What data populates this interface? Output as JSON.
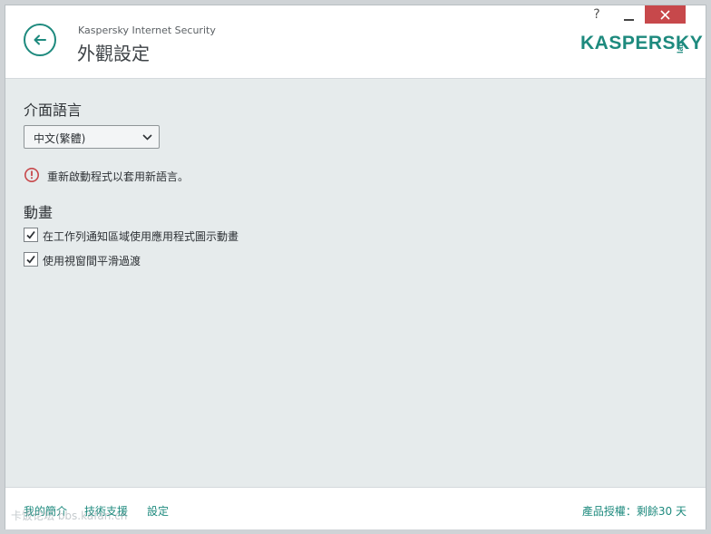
{
  "window": {
    "app_name": "Kaspersky Internet Security",
    "page_title": "外觀設定",
    "help_label": "?",
    "logo_text": "KASPERSKY",
    "logo_lab": "lab"
  },
  "language": {
    "section_title": "介面語言",
    "selected": "中文(繁體)",
    "restart_notice": "重新啟動程式以套用新語言。"
  },
  "animation": {
    "section_title": "動畫",
    "options": [
      {
        "label": "在工作列通知區域使用應用程式圖示動畫",
        "checked": true
      },
      {
        "label": "使用視窗間平滑過渡",
        "checked": true
      }
    ]
  },
  "footer": {
    "links": [
      "我的簡介",
      "技術支援",
      "設定"
    ],
    "license": "產品授權：剩餘30 天",
    "watermark": "卡饭论坛 bbs.kafan.cn"
  },
  "colors": {
    "accent": "#1e8a7e",
    "close": "#c7484b",
    "warning": "#c7484b",
    "background": "#e6ebec"
  }
}
